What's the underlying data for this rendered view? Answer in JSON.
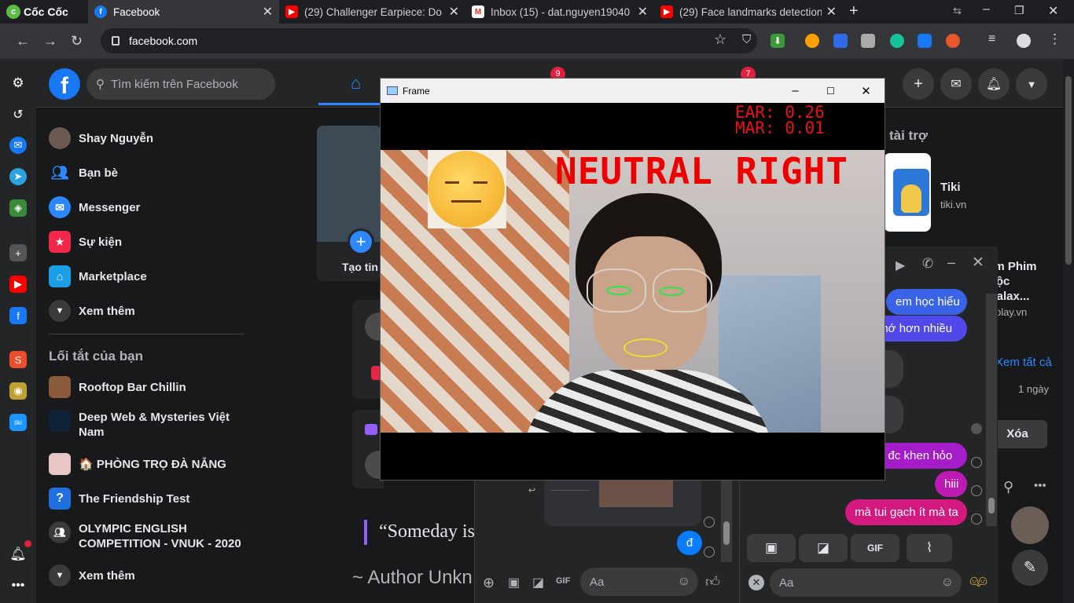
{
  "browser": {
    "brand": "Cốc Cốc",
    "tabs": [
      {
        "title": "Facebook",
        "favicon": "facebook-icon",
        "active": true
      },
      {
        "title": "(29) Challenger Earpiece: Do Y",
        "favicon": "youtube-icon"
      },
      {
        "title": "Inbox (15) - dat.nguyen19040",
        "favicon": "gmail-icon"
      },
      {
        "title": "(29) Face landmarks detection",
        "favicon": "youtube-icon"
      }
    ],
    "url": "facebook.com"
  },
  "facebook": {
    "search_placeholder": "Tìm kiếm trên Facebook",
    "badges": {
      "friends": "9",
      "notifications": "7"
    },
    "left_nav": [
      {
        "label": "Shay Nguyễn",
        "icon": "avatar"
      },
      {
        "label": "Bạn bè",
        "icon": "friends-icon"
      },
      {
        "label": "Messenger",
        "icon": "messenger-icon"
      },
      {
        "label": "Sự kiện",
        "icon": "calendar-icon"
      },
      {
        "label": "Marketplace",
        "icon": "marketplace-icon"
      },
      {
        "label": "Xem thêm",
        "icon": "chevron-down-icon"
      }
    ],
    "shortcuts_title": "Lối tắt của bạn",
    "shortcuts": [
      {
        "label": "Rooftop Bar Chillin"
      },
      {
        "label": "Deep Web & Mysteries Việt Nam"
      },
      {
        "label": "🏠 PHÒNG TRỌ ĐÀ NẴNG"
      },
      {
        "label": "The Friendship Test"
      },
      {
        "label": "OLYMPIC ENGLISH COMPETITION - VNUK - 2020"
      },
      {
        "label": "Xem thêm"
      }
    ],
    "story_label": "Tạo tin",
    "quote": "“Someday is",
    "quote_author": "~ Author Unkn",
    "sponsored_title": "tài trợ",
    "ads": [
      {
        "name": "Tiki",
        "domain": "tiki.vn"
      },
      {
        "name": "em Phim Độc Galax...",
        "domain": "play.vn"
      }
    ],
    "see_all": "Xem tất cả",
    "time_ago": "1 ngày",
    "delete_label": "Xóa"
  },
  "frame_window": {
    "title": "Frame",
    "ear": "EAR: 0.26",
    "mar": "MAR: 0.01",
    "emotion_label": "NEUTRAL RIGHT"
  },
  "chat_right": {
    "messages": [
      {
        "text": "em học hiểu",
        "color": "#3a63e8"
      },
      {
        "text": "nhớ hơn nhiều",
        "color": "#5048e8"
      },
      {
        "text": "à đc khen hỏo",
        "color": "#a51cc9"
      },
      {
        "text": "hiii",
        "color": "#bd1ab3"
      },
      {
        "text": "mà tui gạch ít mà ta",
        "color": "#d41980"
      }
    ],
    "input_placeholder": "Aa"
  },
  "chat_left": {
    "messages": [
      {
        "text": "đ",
        "color": "#0a7cff"
      }
    ],
    "input_placeholder": "Aa"
  }
}
